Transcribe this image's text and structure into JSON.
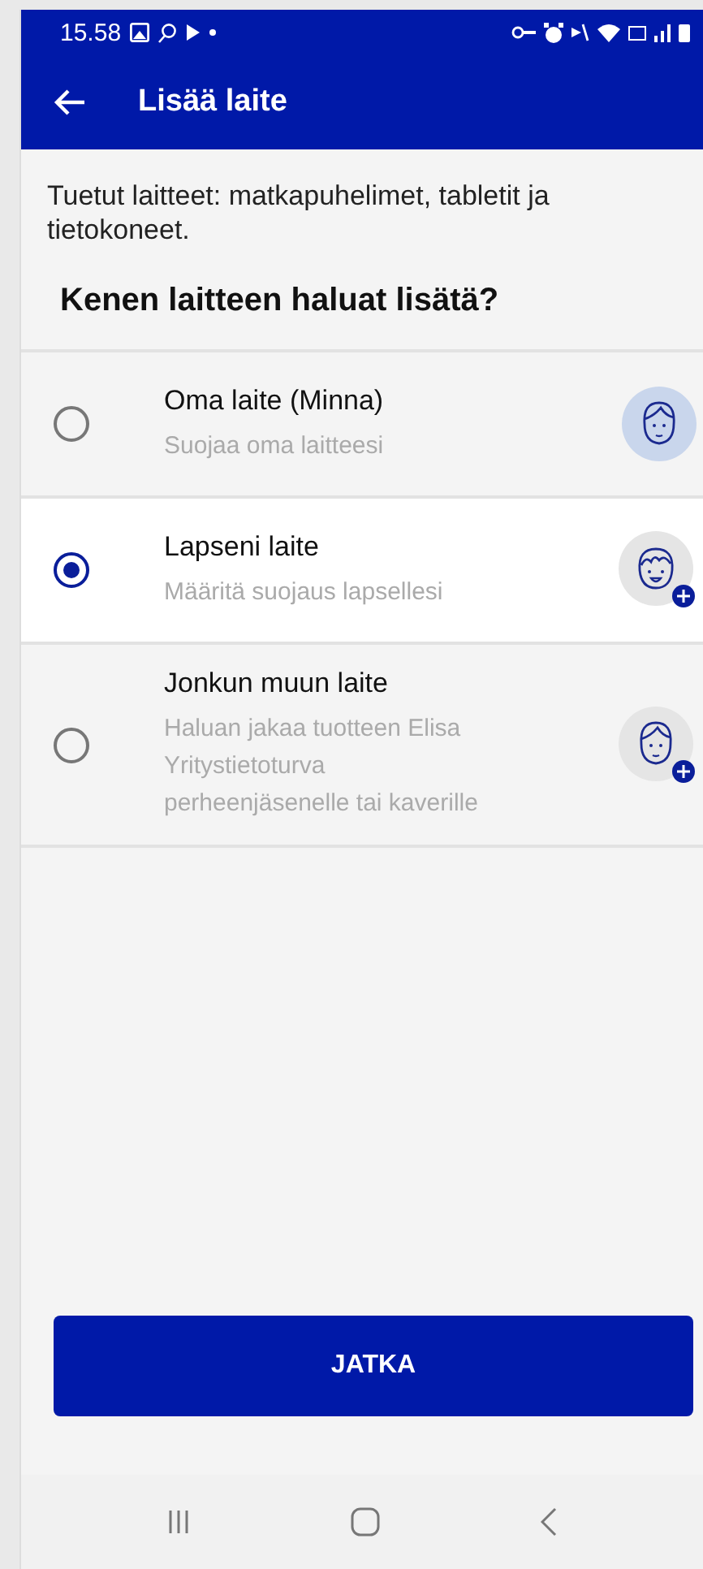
{
  "status_bar": {
    "time": "15.58"
  },
  "app_bar": {
    "title": "Lisää laite"
  },
  "intro": "Tuetut laitteet: matkapuhelimet, tabletit ja tietokoneet.",
  "question": "Kenen laitteen haluat lisätä?",
  "options": [
    {
      "title": "Oma laite (Minna)",
      "subtitle": "Suojaa oma laitteesi",
      "selected": false,
      "kind": "self"
    },
    {
      "title": "Lapseni laite",
      "subtitle": "Määritä suojaus lapsellesi",
      "selected": true,
      "kind": "child"
    },
    {
      "title": "Jonkun muun laite",
      "subtitle": "Haluan jakaa tuotteen Elisa Yritystietoturva perheenjäsenelle tai kaverille",
      "selected": false,
      "kind": "other"
    }
  ],
  "continue_button": "JATKA"
}
